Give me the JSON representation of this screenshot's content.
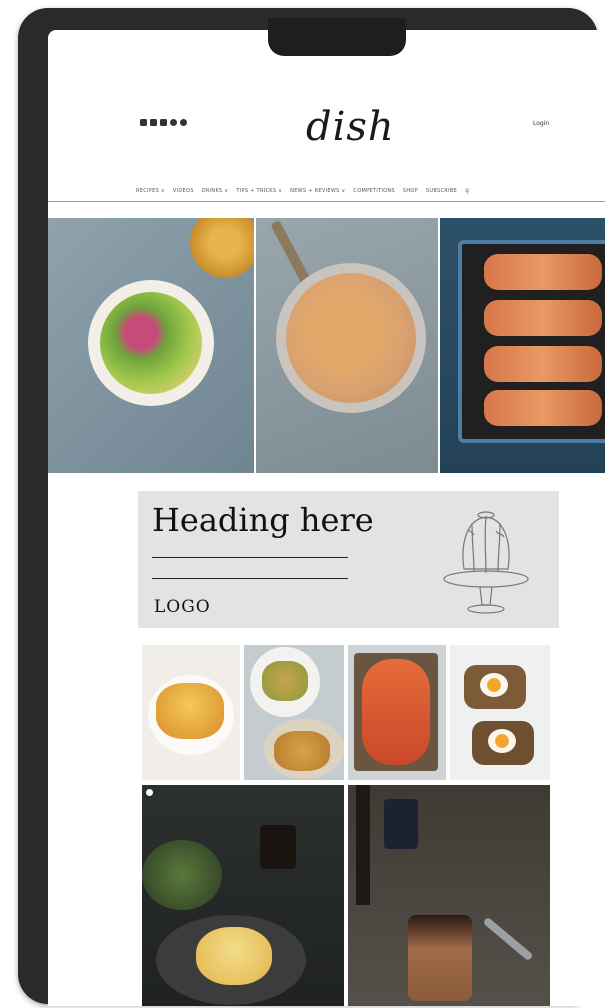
{
  "header": {
    "brand": "dish",
    "login": "Login",
    "social_icons": [
      "facebook-icon",
      "twitter-icon",
      "youtube-icon",
      "pinterest-icon",
      "instagram-icon"
    ]
  },
  "nav": {
    "items": [
      "RECIPES ∨",
      "VIDEOS",
      "DRINKS ∨",
      "TIPS + TRICKS ∨",
      "NEWS + REVIEWS ∨",
      "COMPETITIONS",
      "SHOP",
      "SUBSCRIBE"
    ],
    "search_icon": "search-icon"
  },
  "card": {
    "heading": "Heading here",
    "logo": "LOGO",
    "illustration": "jelly-dessert-icon"
  },
  "colors": {
    "card_bg": "#e3e3e3",
    "frame": "#2a2a2a",
    "text": "#111111"
  }
}
